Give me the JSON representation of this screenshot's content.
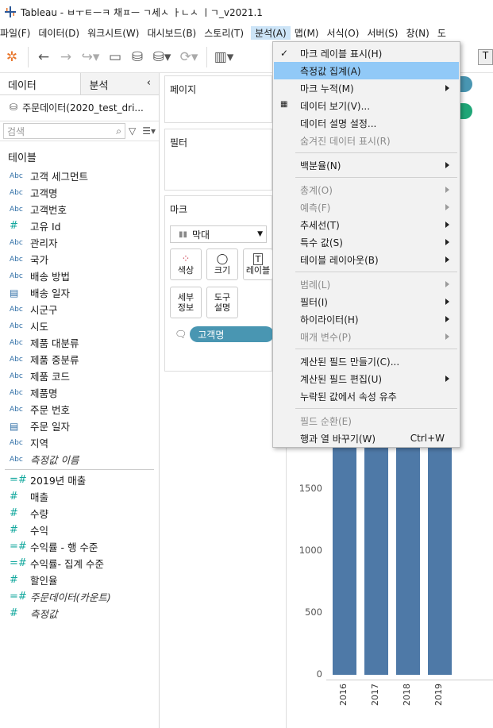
{
  "title": "Tableau - ㅂㅜㅌㅡㅋ 채ㅍㅡ ㄱ세ㅅ ㅏㄴㅅ ㅣㄱ_v2021.1",
  "menus": [
    "파일(F)",
    "데이터(D)",
    "워크시트(W)",
    "대시보드(B)",
    "스토리(T)",
    "분석(A)",
    "맵(M)",
    "서식(O)",
    "서버(S)",
    "창(N)",
    "도"
  ],
  "left_panel": {
    "tab_data": "데이터",
    "tab_analysis": "분석",
    "datasource": "주문데이터(2020_test_dri...",
    "search_placeholder": "검색",
    "section_tables": "테이블",
    "dimensions": [
      {
        "type": "Abc",
        "label": "고객 세그먼트"
      },
      {
        "type": "Abc",
        "label": "고객명"
      },
      {
        "type": "Abc",
        "label": "고객번호"
      },
      {
        "type": "#",
        "label": "고유 Id"
      },
      {
        "type": "Abc",
        "label": "관리자"
      },
      {
        "type": "Abc",
        "label": "국가"
      },
      {
        "type": "Abc",
        "label": "배송 방법"
      },
      {
        "type": "date",
        "label": "배송 일자"
      },
      {
        "type": "Abc",
        "label": "시군구"
      },
      {
        "type": "Abc",
        "label": "시도"
      },
      {
        "type": "Abc",
        "label": "제품 대분류"
      },
      {
        "type": "Abc",
        "label": "제품 중분류"
      },
      {
        "type": "Abc",
        "label": "제품 코드"
      },
      {
        "type": "Abc",
        "label": "제품명"
      },
      {
        "type": "Abc",
        "label": "주문 번호"
      },
      {
        "type": "date",
        "label": "주문 일자"
      },
      {
        "type": "Abc",
        "label": "지역"
      },
      {
        "type": "Abc",
        "label": "측정값 이름",
        "italic": true
      }
    ],
    "measures": [
      {
        "type": "=#",
        "label": "2019년 매출"
      },
      {
        "type": "#",
        "label": "매출"
      },
      {
        "type": "#",
        "label": "수량"
      },
      {
        "type": "#",
        "label": "수익"
      },
      {
        "type": "=#",
        "label": "수익률 - 행 수준"
      },
      {
        "type": "=#",
        "label": "수익률- 집계 수준"
      },
      {
        "type": "#",
        "label": "할인율"
      },
      {
        "type": "=#",
        "label": "주문데이터(카운트)",
        "italic": true
      },
      {
        "type": "#",
        "label": "측정값",
        "italic": true
      }
    ]
  },
  "shelves": {
    "pages": "페이지",
    "filters": "필터",
    "marks": "마크",
    "mark_type": "막대",
    "cards": {
      "color": "색상",
      "size": "크기",
      "label": "레이블",
      "detail": "세부\n정보",
      "tooltip": "도구\n설명"
    },
    "detail_pill": "고객명"
  },
  "analysis_menu": [
    {
      "label": "마크 레이블 표시(H)",
      "checked": true
    },
    {
      "label": "측정값 집계(A)",
      "highlighted": true
    },
    {
      "label": "마크 누적(M)",
      "submenu": true
    },
    {
      "label": "데이터 보기(V)..."
    },
    {
      "label": "데이터 설명 설정..."
    },
    {
      "label": "숨겨진 데이터 표시(R)",
      "disabled": true
    },
    {
      "label": "백분율(N)",
      "submenu": true
    },
    {
      "label": "총계(O)",
      "submenu": true,
      "disabled": true
    },
    {
      "label": "예측(F)",
      "submenu": true,
      "disabled": true
    },
    {
      "label": "추세선(T)",
      "submenu": true
    },
    {
      "label": "특수 값(S)",
      "submenu": true
    },
    {
      "label": "테이블 레이아웃(B)",
      "submenu": true
    },
    {
      "label": "범례(L)",
      "submenu": true,
      "disabled": true
    },
    {
      "label": "필터(I)",
      "submenu": true
    },
    {
      "label": "하이라이터(H)",
      "submenu": true
    },
    {
      "label": "매개 변수(P)",
      "submenu": true,
      "disabled": true
    },
    {
      "label": "계산된 필드 만들기(C)..."
    },
    {
      "label": "계산된 필드 편집(U)",
      "submenu": true
    },
    {
      "label": "누락된 값에서 속성 유추"
    },
    {
      "label": "필드 순환(E)",
      "disabled": true
    },
    {
      "label": "행과 열 바꾸기(W)",
      "shortcut": "Ctrl+W"
    }
  ],
  "chart_data": {
    "type": "bar",
    "categories": [
      "2016",
      "2017",
      "2018",
      "2019"
    ],
    "yticks": [
      0,
      500,
      1000,
      1500
    ],
    "bar_color": "#4e79a7"
  }
}
